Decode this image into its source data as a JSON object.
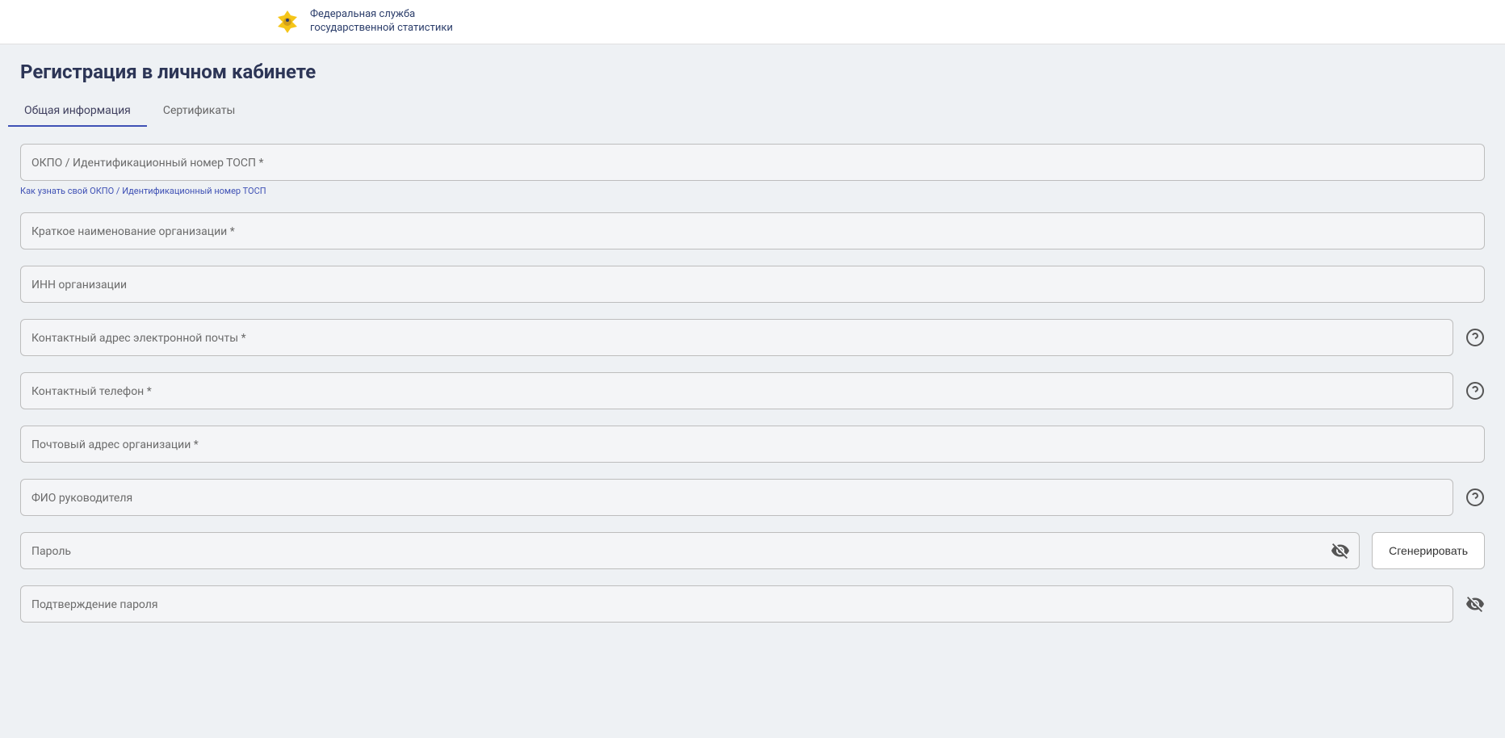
{
  "header": {
    "org_line1": "Федеральная служба",
    "org_line2": "государственной статистики"
  },
  "page": {
    "title": "Регистрация в личном кабинете"
  },
  "tabs": {
    "general": "Общая информация",
    "certificates": "Сертификаты"
  },
  "fields": {
    "okpo": {
      "label": "ОКПО / Идентификационный номер ТОСП *",
      "value": "",
      "help_link": "Как узнать свой ОКПО / Идентификационный номер ТОСП"
    },
    "short_name": {
      "label": "Краткое наименование организации *",
      "value": ""
    },
    "inn": {
      "label": "ИНН организации",
      "value": ""
    },
    "email": {
      "label": "Контактный адрес электронной почты *",
      "value": ""
    },
    "phone": {
      "label": "Контактный телефон *",
      "value": ""
    },
    "postal": {
      "label": "Почтовый адрес организации *",
      "value": ""
    },
    "director": {
      "label": "ФИО руководителя",
      "value": ""
    },
    "password": {
      "label": "Пароль",
      "value": ""
    },
    "password_confirm": {
      "label": "Подтверждение пароля",
      "value": ""
    }
  },
  "buttons": {
    "generate": "Сгенерировать"
  }
}
